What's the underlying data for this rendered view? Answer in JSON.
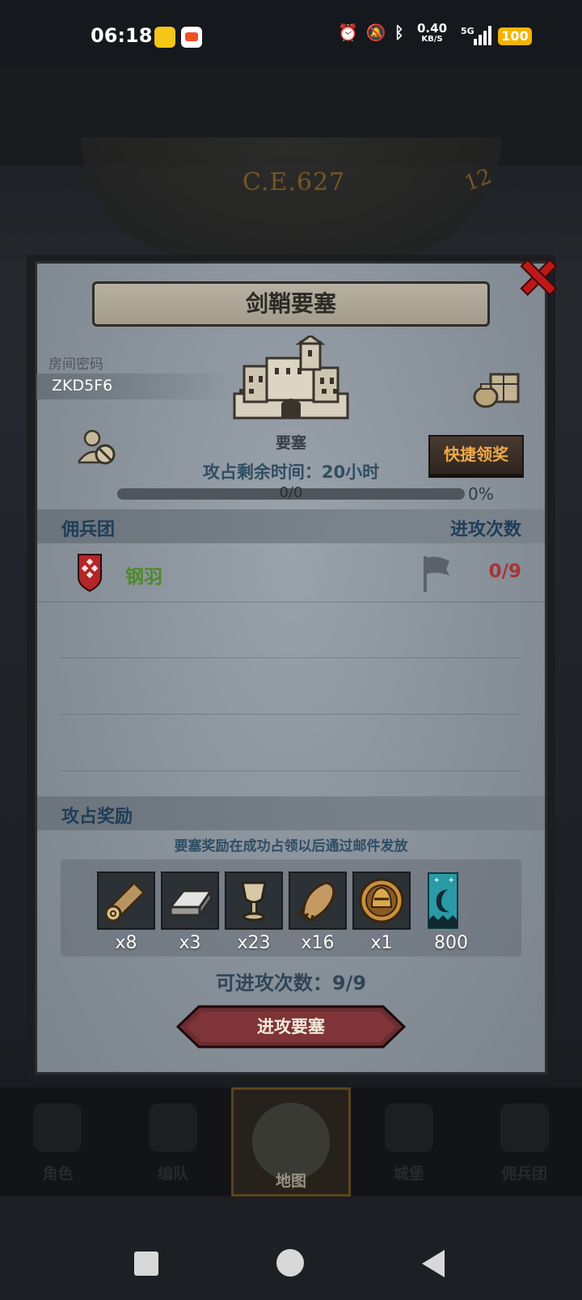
{
  "status_bar": {
    "time": "06:18",
    "net_speed": "0.40",
    "net_speed_unit": "KB/S",
    "network": "5G",
    "battery": "100",
    "icons": [
      "alarm-icon",
      "mute-icon",
      "bluetooth-icon"
    ]
  },
  "background": {
    "era": "C.E.627",
    "dial_number": "12"
  },
  "dialog": {
    "title": "剑鞘要塞",
    "room_label": "房间密码",
    "room_code": "ZKD5F6",
    "fortress_label": "要塞",
    "quick_claim": "快捷领奖",
    "remaining_time": "攻占剩余时间：20小时",
    "progress_count": "0/0",
    "progress_percent": "0%",
    "progress_value": 0,
    "mercenary_header": "佣兵团",
    "attack_count_header": "进攻次数",
    "guild": {
      "name": "钢羽",
      "attacks": "0/9"
    },
    "reward_header": "攻占奖励",
    "reward_note": "要塞奖励在成功占领以后通过邮件发放",
    "rewards": [
      {
        "icon": "wood-log-icon",
        "qty": "x8"
      },
      {
        "icon": "iron-ingot-icon",
        "qty": "x3"
      },
      {
        "icon": "goblet-icon",
        "qty": "x23"
      },
      {
        "icon": "fur-pelt-icon",
        "qty": "x16"
      },
      {
        "icon": "knight-helmet-coin-icon",
        "qty": "x1"
      },
      {
        "icon": "banner-icon",
        "qty": "800"
      }
    ],
    "available_attacks": "可进攻次数：9/9",
    "attack_button": "进攻要塞"
  },
  "bottom_nav": {
    "items": [
      {
        "label": "角色",
        "icon": "knight-icon"
      },
      {
        "label": "编队",
        "icon": "squad-icon"
      },
      {
        "label": "地图",
        "icon": "compass-map-icon",
        "active": true
      },
      {
        "label": "城堡",
        "icon": "castle-icon"
      },
      {
        "label": "佣兵团",
        "icon": "mercenary-icon"
      }
    ]
  },
  "colors": {
    "accent_gold": "#c9a441",
    "close_red": "#c01818",
    "guild_green": "#4c8a2a",
    "attack_red": "#a6343a",
    "button_orange": "#f0a84a"
  }
}
